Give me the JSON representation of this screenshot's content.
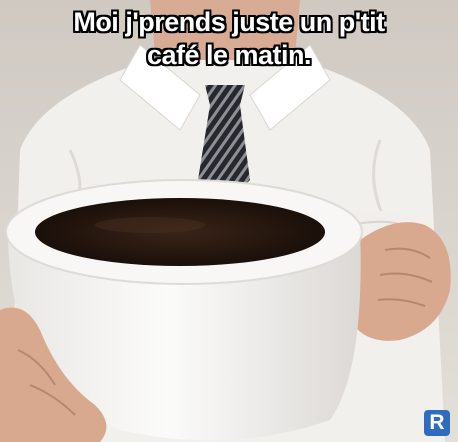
{
  "caption": {
    "line1": "Moi j'prends juste un p'tit",
    "line2": "café le matin."
  },
  "badge": {
    "label": "R",
    "color": "#2f6cc0"
  },
  "colors": {
    "background": "#d9d4cd",
    "shirt": "#f3f1ee",
    "tie": "#2b2d33",
    "mug": "#f7f6f4",
    "coffee": "#2a1a12",
    "skin": "#d9a98f"
  }
}
